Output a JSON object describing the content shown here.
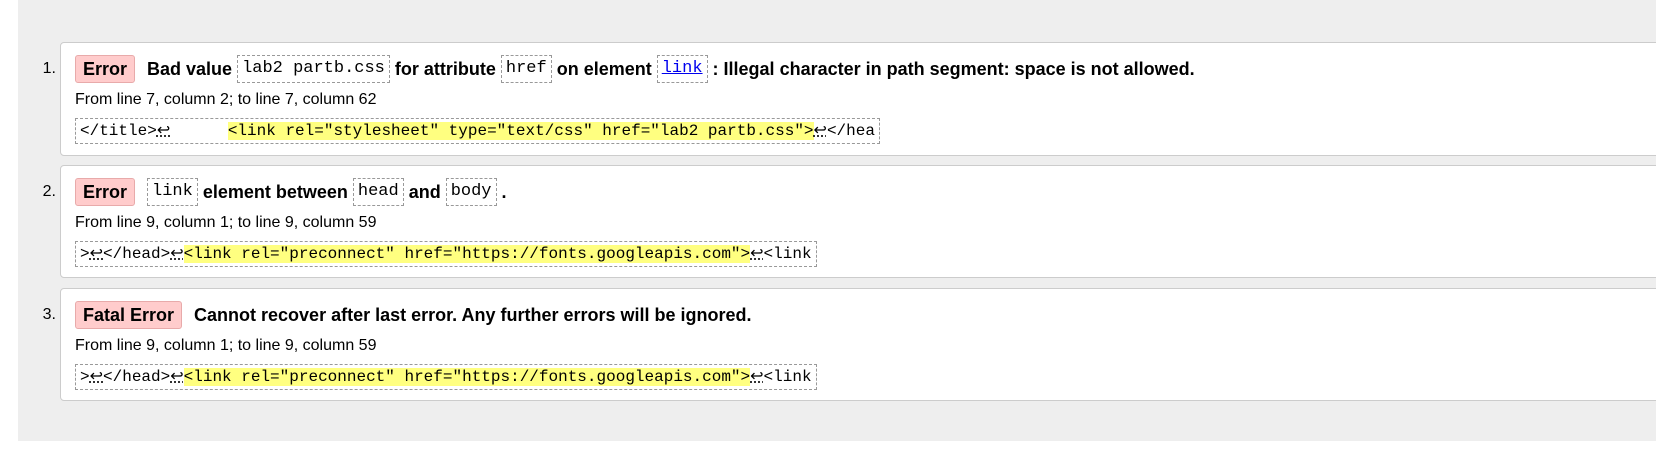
{
  "messages": [
    {
      "number": "1.",
      "badge": "Error",
      "parts": {
        "bad_value": "Bad value",
        "value": "lab2 partb.css",
        "for_attribute": "for attribute",
        "attribute": "href",
        "on_element": "on element",
        "element": "link",
        "rest": ": Illegal character in path segment: space is not allowed."
      },
      "location": "From line 7, column 2; to line 7, column 62",
      "extract": {
        "before": "</title>",
        "lf1": "↩",
        "gap": "      ",
        "highlight": "<link rel=\"stylesheet\" type=\"text/css\" href=\"lab2 partb.css\">",
        "lf2": "↩",
        "after": "</hea"
      }
    },
    {
      "number": "2.",
      "badge": "Error",
      "parts": {
        "element": "link",
        "between": "element between",
        "head": "head",
        "and": "and",
        "body": "body",
        "end": "."
      },
      "location": "From line 9, column 1; to line 9, column 59",
      "extract": {
        "before": ">",
        "lf1": "↩",
        "mid": "</head>",
        "lf2": "↩",
        "highlight": "<link rel=\"preconnect\" href=\"https://fonts.googleapis.com\">",
        "lf3": "↩",
        "after": "<link"
      }
    },
    {
      "number": "3.",
      "badge": "Fatal Error",
      "text": "Cannot recover after last error. Any further errors will be ignored.",
      "location": "From line 9, column 1; to line 9, column 59",
      "extract": {
        "before": ">",
        "lf1": "↩",
        "mid": "</head>",
        "lf2": "↩",
        "highlight": "<link rel=\"preconnect\" href=\"https://fonts.googleapis.com\">",
        "lf3": "↩",
        "after": "<link"
      }
    }
  ]
}
